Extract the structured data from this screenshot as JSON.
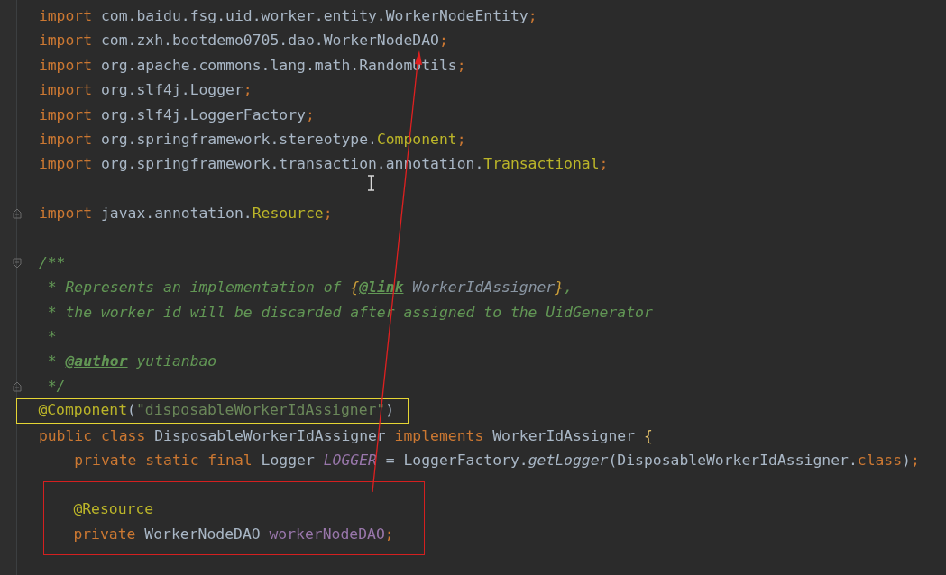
{
  "editor": {
    "blocks": [
      {
        "lines": [
          {
            "tokens": [
              {
                "kind": "kw",
                "text": "import "
              },
              {
                "kind": "plain",
                "text": "com.baidu.fsg.uid.worker.entity.WorkerNodeEntity"
              },
              {
                "kind": "kw",
                "text": ";"
              }
            ]
          },
          {
            "tokens": [
              {
                "kind": "kw",
                "text": "import "
              },
              {
                "kind": "plain",
                "text": "com.zxh.bootdemo0705.dao.WorkerNodeDAO"
              },
              {
                "kind": "kw",
                "text": ";"
              }
            ]
          },
          {
            "tokens": [
              {
                "kind": "kw",
                "text": "import "
              },
              {
                "kind": "plain",
                "text": "org.apache.commons.lang.math.RandomUtils"
              },
              {
                "kind": "kw",
                "text": ";"
              }
            ]
          },
          {
            "tokens": [
              {
                "kind": "kw",
                "text": "import "
              },
              {
                "kind": "plain",
                "text": "org.slf4j.Logger"
              },
              {
                "kind": "kw",
                "text": ";"
              }
            ]
          },
          {
            "tokens": [
              {
                "kind": "kw",
                "text": "import "
              },
              {
                "kind": "plain",
                "text": "org.slf4j.LoggerFactory"
              },
              {
                "kind": "kw",
                "text": ";"
              }
            ]
          },
          {
            "tokens": [
              {
                "kind": "kw",
                "text": "import "
              },
              {
                "kind": "plain",
                "text": "org.springframework.stereotype."
              },
              {
                "kind": "anno",
                "text": "Component"
              },
              {
                "kind": "kw",
                "text": ";"
              }
            ]
          },
          {
            "tokens": [
              {
                "kind": "kw",
                "text": "import "
              },
              {
                "kind": "plain",
                "text": "org.springframework.transaction.annotation."
              },
              {
                "kind": "anno",
                "text": "Transactional"
              },
              {
                "kind": "kw",
                "text": ";"
              }
            ]
          }
        ]
      },
      {
        "lines": [
          {
            "fold_end": true,
            "tokens": [
              {
                "kind": "kw",
                "text": "import "
              },
              {
                "kind": "plain",
                "text": "javax.annotation."
              },
              {
                "kind": "anno",
                "text": "Resource"
              },
              {
                "kind": "kw",
                "text": ";"
              }
            ]
          }
        ]
      },
      {
        "lines": [
          {
            "fold_start": true,
            "tokens": [
              {
                "kind": "comment",
                "text": "/**"
              }
            ]
          },
          {
            "tokens": [
              {
                "kind": "comment",
                "text": " * Represents an implementation of "
              },
              {
                "kind": "docbrace",
                "text": "{"
              },
              {
                "kind": "doctag",
                "text": "@link"
              },
              {
                "kind": "docref",
                "text": " WorkerIdAssigner"
              },
              {
                "kind": "docbrace",
                "text": "}"
              },
              {
                "kind": "comment",
                "text": ","
              }
            ]
          },
          {
            "tokens": [
              {
                "kind": "comment",
                "text": " * the worker id will be discarded after assigned to the UidGenerator"
              }
            ]
          },
          {
            "tokens": [
              {
                "kind": "comment",
                "text": " *"
              }
            ]
          },
          {
            "tokens": [
              {
                "kind": "comment",
                "text": " * "
              },
              {
                "kind": "doctag",
                "text": "@author"
              },
              {
                "kind": "comment",
                "text": " yutianbao"
              }
            ]
          },
          {
            "fold_end": true,
            "tokens": [
              {
                "kind": "comment",
                "text": " */"
              }
            ]
          },
          {
            "color": "#e5d534",
            "tokens": [
              {
                "kind": "anno",
                "text": "@Component"
              },
              {
                "kind": "plain",
                "text": "("
              },
              {
                "kind": "string",
                "text": "\"disposableWorkerIdAssigner\""
              },
              {
                "kind": "plain",
                "text": ")"
              }
            ]
          },
          {
            "tokens": [
              {
                "kind": "kw",
                "text": "public class "
              },
              {
                "kind": "plain",
                "text": "DisposableWorkerIdAssigner "
              },
              {
                "kind": "kw",
                "text": "implements "
              },
              {
                "kind": "plain",
                "text": "WorkerIdAssigner "
              },
              {
                "kind": "brace",
                "text": "{"
              }
            ]
          },
          {
            "tokens": [
              {
                "kind": "kw",
                "text": "    private static final "
              },
              {
                "kind": "plain",
                "text": "Logger "
              },
              {
                "kind": "staticfield",
                "text": "LOGGER"
              },
              {
                "kind": "plain",
                "text": " = LoggerFactory."
              },
              {
                "kind": "method",
                "text": "getLogger"
              },
              {
                "kind": "plain",
                "text": "(DisposableWorkerIdAssigner."
              },
              {
                "kind": "kw",
                "text": "class"
              },
              {
                "kind": "plain",
                "text": ")"
              },
              {
                "kind": "kw",
                "text": ";"
              }
            ]
          }
        ]
      },
      {
        "color": "#d42020",
        "lines": [
          {
            "tokens": [
              {
                "kind": "anno",
                "text": "@Resource"
              }
            ]
          },
          {
            "tokens": [
              {
                "kind": "kw",
                "text": "private "
              },
              {
                "kind": "plain",
                "text": "WorkerNodeDAO "
              },
              {
                "kind": "field",
                "text": "workerNodeDAO"
              },
              {
                "kind": "kw",
                "text": ";"
              }
            ]
          }
        ]
      }
    ]
  }
}
